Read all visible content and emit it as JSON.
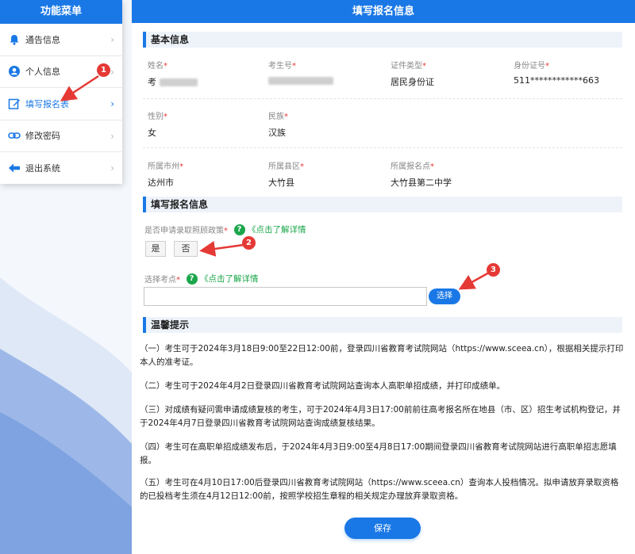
{
  "sidebar": {
    "title": "功能菜单",
    "items": [
      {
        "label": "通告信息",
        "icon": "bell-icon"
      },
      {
        "label": "个人信息",
        "icon": "user-icon"
      },
      {
        "label": "填写报名表",
        "icon": "edit-icon"
      },
      {
        "label": "修改密码",
        "icon": "link-icon"
      },
      {
        "label": "退出系统",
        "icon": "exit-icon"
      }
    ],
    "active_index": 2
  },
  "main": {
    "title": "填写报名信息",
    "basic_section_title": "基本信息",
    "fields": {
      "name": {
        "label": "姓名",
        "value": "考"
      },
      "exam_no": {
        "label": "考生号",
        "value": ""
      },
      "id_type": {
        "label": "证件类型",
        "value": "居民身份证"
      },
      "id_no": {
        "label": "身份证号",
        "value": "511************663"
      },
      "gender": {
        "label": "性别",
        "value": "女"
      },
      "ethnicity": {
        "label": "民族",
        "value": "汉族"
      },
      "city": {
        "label": "所属市州",
        "value": "达州市"
      },
      "county": {
        "label": "所属县区",
        "value": "大竹县"
      },
      "site": {
        "label": "所属报名点",
        "value": "大竹县第二中学"
      }
    },
    "required_mark": "*",
    "form_section_title": "填写报名信息",
    "policy_question": "是否申请录取照顾政策",
    "detail_link": "《点击了解详情",
    "help_icon_char": "?",
    "yes_label": "是",
    "no_label": "否",
    "select_site_label": "选择考点",
    "select_site_value": "",
    "select_button": "选择",
    "tips_section_title": "温馨提示",
    "tips": [
      "（一）考生可于2024年3月18日9:00至22日12:00前，登录四川省教育考试院网站（https://www.sceea.cn），根据相关提示打印本人的准考证。",
      "（二）考生可于2024年4月2日登录四川省教育考试院网站查询本人高职单招成绩，并打印成绩单。",
      "（三）对成绩有疑问需申请成绩复核的考生，可于2024年4月3日17:00前前往高考报名所在地县（市、区）招生考试机构登记，并于2024年4月7日登录四川省教育考试院网站查询成绩复核结果。",
      "（四）考生可在高职单招成绩发布后，于2024年4月3日9:00至4月8日17:00期间登录四川省教育考试院网站进行高职单招志愿填报。",
      "（五）考生可在4月10日17:00后登录四川省教育考试院网站（https://www.sceea.cn）查询本人投档情况。拟申请放弃录取资格的已投档考生须在4月12日12:00前，按照学校招生章程的相关规定办理放弃录取资格。"
    ],
    "save_button": "保存"
  },
  "annotations": {
    "badges": [
      "1",
      "2",
      "3"
    ]
  },
  "colors": {
    "primary": "#1a78e6",
    "danger": "#e53935",
    "success": "#1ba64b"
  }
}
